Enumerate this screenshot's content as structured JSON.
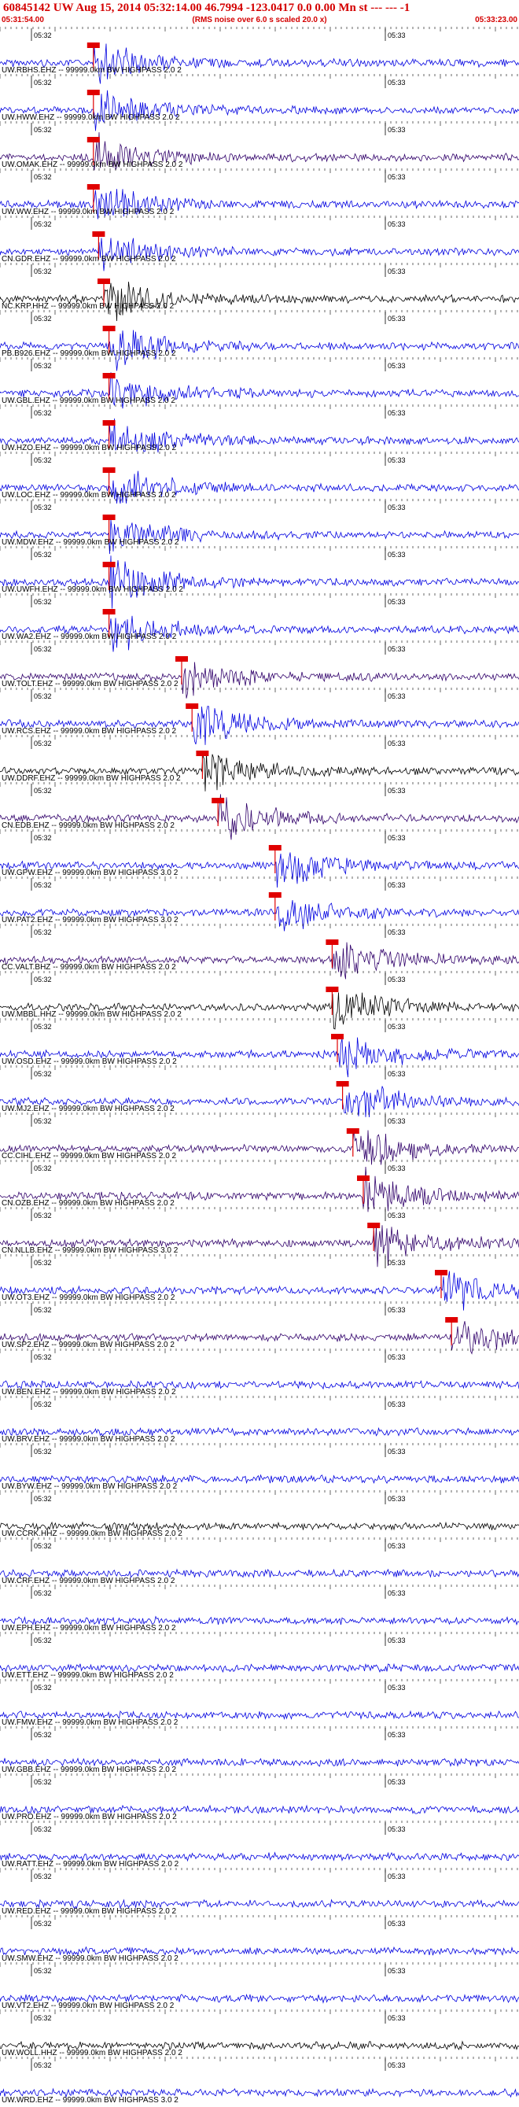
{
  "header": {
    "title": "60845142 UW Aug 15, 2014 05:32:14.00   46.7994 -123.0417  0.0 0.00 Mn st --- --- -1",
    "start_time": "05:31:54.00",
    "scale_note": "(RMS noise over 6.0 s scaled 20.0 x)",
    "end_time": "05:33:23.00"
  },
  "tick_labels": {
    "left": "05:32",
    "right": "05:33"
  },
  "colors": {
    "blue": "#0000e0",
    "black": "#000000",
    "purple": "#30006a",
    "pick": "#e00000",
    "title": "#d40000"
  },
  "stations": [
    {
      "label": "UW.RBHS.EHZ -- 99999.0km BW  HIGHPASS  2.0  2",
      "color": "blue",
      "pick": 0.18
    },
    {
      "label": "UW.HWW.EHZ -- 99999.0km BW  HIGHPASS  2.0  2",
      "color": "blue",
      "pick": 0.18
    },
    {
      "label": "UW.OMAK.EHZ -- 99999.0km BW  HIGHPASS  2.0  2",
      "color": "purple",
      "pick": 0.18
    },
    {
      "label": "UW.WW.EHZ -- 99999.0km BW  HIGHPASS  2.0  2",
      "color": "blue",
      "pick": 0.18
    },
    {
      "label": "CN.GDR.EHZ -- 99999.0km BW  HIGHPASS  2.0  2",
      "color": "blue",
      "pick": 0.19
    },
    {
      "label": "NC.KRP.HHZ -- 99999.0km BW  HIGHPASS  2.0  2",
      "color": "black",
      "pick": 0.2
    },
    {
      "label": "PB.B926.EHZ -- 99999.0km BW  HIGHPASS  2.0  2",
      "color": "blue",
      "pick": 0.21
    },
    {
      "label": "UW.GBL.EHZ -- 99999.0km BW  HIGHPASS  2.0  2",
      "color": "blue",
      "pick": 0.21
    },
    {
      "label": "UW.HZO.EHZ -- 99999.0km BW  HIGHPASS  2.0  2",
      "color": "blue",
      "pick": 0.21
    },
    {
      "label": "UW.LOC.EHZ -- 99999.0km BW  HIGHPASS  2.0  2",
      "color": "blue",
      "pick": 0.21
    },
    {
      "label": "UW.MDW.EHZ -- 99999.0km BW  HIGHPASS  2.0  2",
      "color": "blue",
      "pick": 0.21
    },
    {
      "label": "UW.UWFH.EHZ -- 99999.0km BW  HIGHPASS  2.0  2",
      "color": "blue",
      "pick": 0.21
    },
    {
      "label": "UW.WA2.EHZ -- 99999.0km BW  HIGHPASS  2.0  2",
      "color": "blue",
      "pick": 0.21
    },
    {
      "label": "UW.TOLT.EHZ -- 99999.0km BW  HIGHPASS  2.0  2",
      "color": "purple",
      "pick": 0.35
    },
    {
      "label": "UW.RCS.EHZ -- 99999.0km BW  HIGHPASS  2.0  2",
      "color": "blue",
      "pick": 0.37
    },
    {
      "label": "UW.DDRF.EHZ -- 99999.0km BW  HIGHPASS  2.0  2",
      "color": "black",
      "pick": 0.39
    },
    {
      "label": "CN.EDB.EHZ -- 99999.0km BW  HIGHPASS  2.0  2",
      "color": "purple",
      "pick": 0.42
    },
    {
      "label": "UW.GPW.EHZ -- 99999.0km BW  HIGHPASS  3.0  2",
      "color": "blue",
      "pick": 0.53
    },
    {
      "label": "UW.PAT2.EHZ -- 99999.0km BW  HIGHPASS  3.0  2",
      "color": "blue",
      "pick": 0.53
    },
    {
      "label": "CC.VALT.BHZ -- 99999.0km BW  HIGHPASS  2.0  2",
      "color": "purple",
      "pick": 0.64
    },
    {
      "label": "UW.MBBL.HHZ -- 99999.0km BW  HIGHPASS  2.0  2",
      "color": "black",
      "pick": 0.64
    },
    {
      "label": "UW.OSD.EHZ -- 99999.0km BW  HIGHPASS  2.0  2",
      "color": "blue",
      "pick": 0.65
    },
    {
      "label": "UW.MJ2.EHZ -- 99999.0km BW  HIGHPASS  2.0  2",
      "color": "blue",
      "pick": 0.66
    },
    {
      "label": "CC.CIHL.EHZ -- 99999.0km BW  HIGHPASS  2.0  2",
      "color": "purple",
      "pick": 0.68
    },
    {
      "label": "CN.OZB.EHZ -- 99999.0km BW  HIGHPASS  2.0  2",
      "color": "purple",
      "pick": 0.7
    },
    {
      "label": "CN.NLLB.EHZ -- 99999.0km BW  HIGHPASS  3.0  2",
      "color": "purple",
      "pick": 0.72
    },
    {
      "label": "UW.OT3.EHZ -- 99999.0km BW  HIGHPASS  2.0  2",
      "color": "blue",
      "pick": 0.85
    },
    {
      "label": "UW.SP2.EHZ -- 99999.0km BW  HIGHPASS  2.0  2",
      "color": "purple",
      "pick": 0.87
    },
    {
      "label": "UW.BEN.EHZ -- 99999.0km BW  HIGHPASS  2.0  2",
      "color": "blue",
      "pick": null
    },
    {
      "label": "UW.BRV.EHZ -- 99999.0km BW  HIGHPASS  2.0  2",
      "color": "blue",
      "pick": null
    },
    {
      "label": "UW.BYW.EHZ -- 99999.0km BW  HIGHPASS  2.0  2",
      "color": "blue",
      "pick": null
    },
    {
      "label": "UW.CCRK.HHZ -- 99999.0km BW  HIGHPASS  2.0  2",
      "color": "black",
      "pick": null
    },
    {
      "label": "UW.CRF.EHZ -- 99999.0km BW  HIGHPASS  2.0  2",
      "color": "blue",
      "pick": null
    },
    {
      "label": "UW.EPH.EHZ -- 99999.0km BW  HIGHPASS  2.0  2",
      "color": "blue",
      "pick": null
    },
    {
      "label": "UW.ETT.EHZ -- 99999.0km BW  HIGHPASS  2.0  2",
      "color": "blue",
      "pick": null
    },
    {
      "label": "UW.FMW.EHZ -- 99999.0km BW  HIGHPASS  2.0  2",
      "color": "blue",
      "pick": null
    },
    {
      "label": "UW.GBB.EHZ -- 99999.0km BW  HIGHPASS  2.0  2",
      "color": "blue",
      "pick": null
    },
    {
      "label": "UW.PRO.EHZ -- 99999.0km BW  HIGHPASS  2.0  2",
      "color": "blue",
      "pick": null
    },
    {
      "label": "UW.RATT.EHZ -- 99999.0km BW  HIGHPASS  2.0  2",
      "color": "blue",
      "pick": null
    },
    {
      "label": "UW.RED.EHZ -- 99999.0km BW  HIGHPASS  2.0  2",
      "color": "blue",
      "pick": null
    },
    {
      "label": "UW.SMW.EHZ -- 99999.0km BW  HIGHPASS  2.0  2",
      "color": "blue",
      "pick": null
    },
    {
      "label": "UW.VT2.EHZ -- 99999.0km BW  HIGHPASS  2.0  2",
      "color": "blue",
      "pick": null
    },
    {
      "label": "UW.WOLL.HHZ -- 99999.0km BW  HIGHPASS  2.0  2",
      "color": "black",
      "pick": null
    },
    {
      "label": "UW.WRD.EHZ -- 99999.0km BW  HIGHPASS  3.0  2",
      "color": "blue",
      "pick": null
    }
  ]
}
